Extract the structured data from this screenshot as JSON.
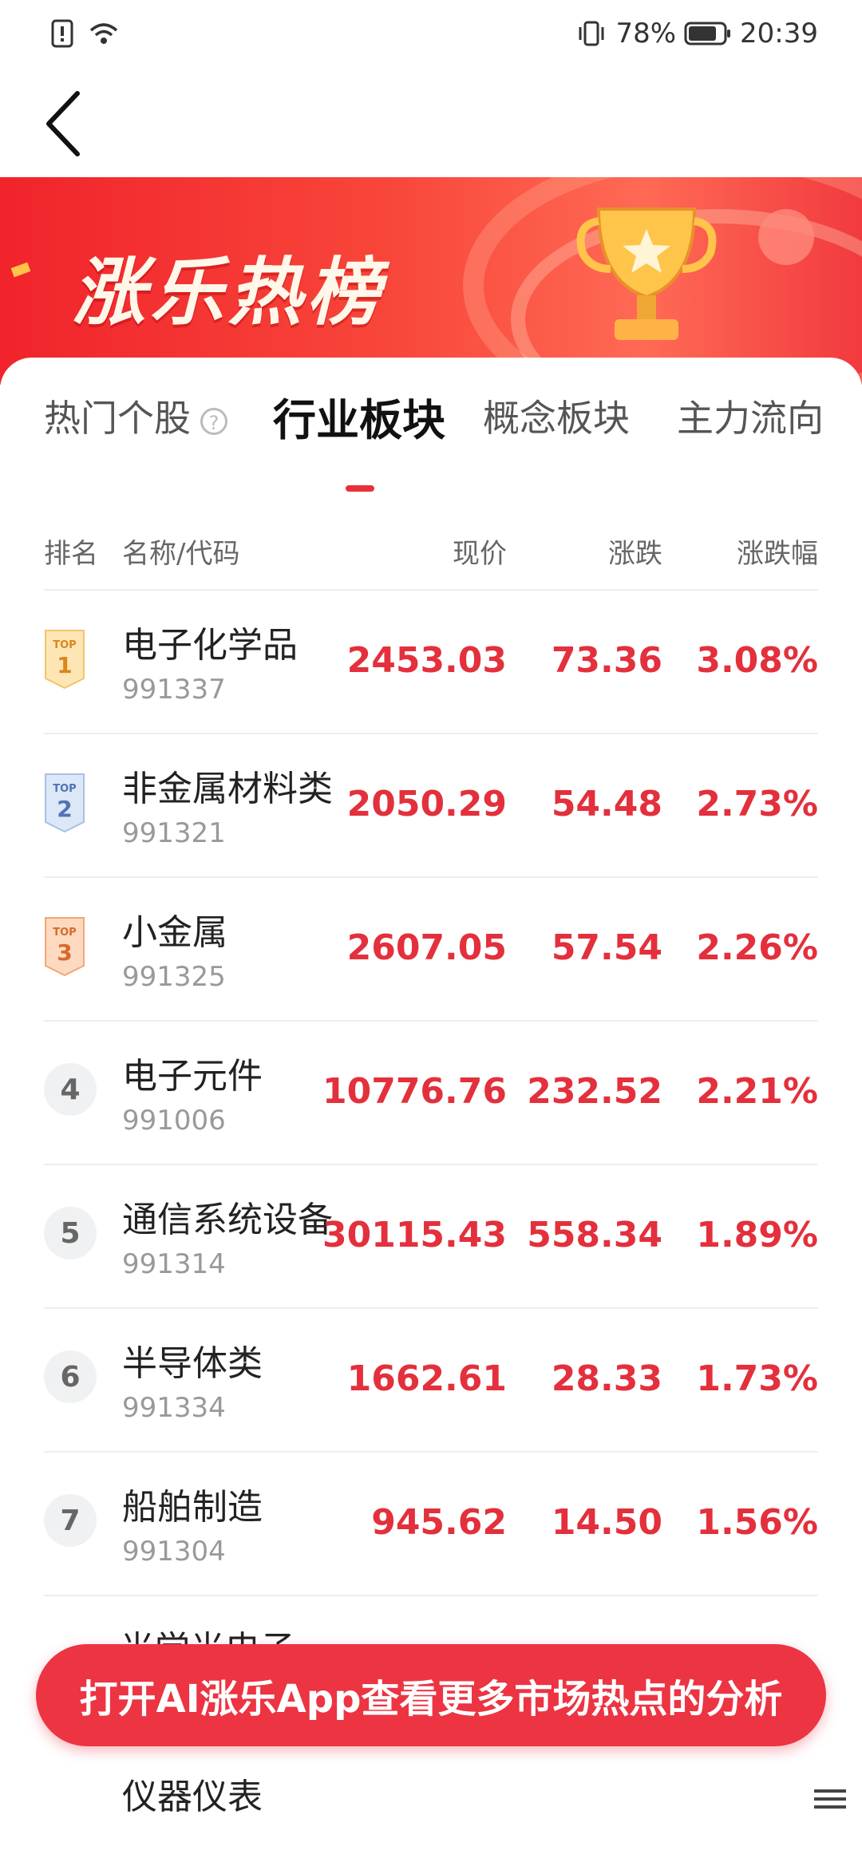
{
  "status_bar": {
    "battery": "78%",
    "time": "20:39"
  },
  "banner": {
    "title": "涨乐热榜"
  },
  "tabs": [
    {
      "label": "热门个股"
    },
    {
      "label": "行业板块"
    },
    {
      "label": "概念板块"
    },
    {
      "label": "主力流向"
    }
  ],
  "help": "?",
  "table": {
    "headers": {
      "rank": "排名",
      "name": "名称/代码",
      "price": "现价",
      "change": "涨跌",
      "pct": "涨跌幅"
    },
    "rows": [
      {
        "rank": "1",
        "badge": "TOP",
        "name": "电子化学品",
        "code": "991337",
        "price": "2453.03",
        "change": "73.36",
        "pct": "3.08%"
      },
      {
        "rank": "2",
        "badge": "TOP",
        "name": "非金属材料类",
        "code": "991321",
        "price": "2050.29",
        "change": "54.48",
        "pct": "2.73%"
      },
      {
        "rank": "3",
        "badge": "TOP",
        "name": "小金属",
        "code": "991325",
        "price": "2607.05",
        "change": "57.54",
        "pct": "2.26%"
      },
      {
        "rank": "4",
        "name": "电子元件",
        "code": "991006",
        "price": "10776.76",
        "change": "232.52",
        "pct": "2.21%"
      },
      {
        "rank": "5",
        "name": "通信系统设备",
        "code": "991314",
        "price": "30115.43",
        "change": "558.34",
        "pct": "1.89%"
      },
      {
        "rank": "6",
        "name": "半导体类",
        "code": "991334",
        "price": "1662.61",
        "change": "28.33",
        "pct": "1.73%"
      },
      {
        "rank": "7",
        "name": "船舶制造",
        "code": "991304",
        "price": "945.62",
        "change": "14.50",
        "pct": "1.56%"
      }
    ],
    "partial_rows": [
      "光学光电子",
      "仪器仪表"
    ]
  },
  "cta": {
    "label": "打开AI涨乐App查看更多市场热点的分析"
  },
  "colors": {
    "accent": "#ec3443",
    "up": "#e3303c"
  }
}
